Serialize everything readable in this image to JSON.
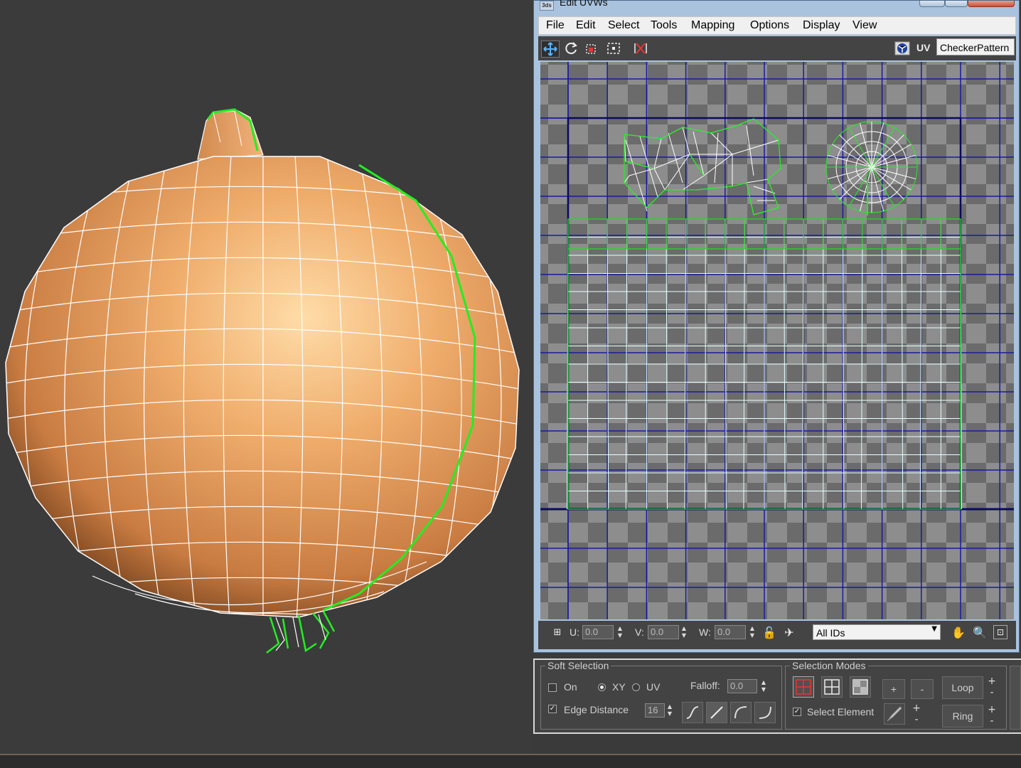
{
  "window": {
    "title": "Edit UVWs",
    "app_icon": "3ds"
  },
  "menu": [
    "File",
    "Edit",
    "Select",
    "Tools",
    "Mapping",
    "Options",
    "Display",
    "View"
  ],
  "toolbar": {
    "uv_label": "UV",
    "texture": "CheckerPattern"
  },
  "status": {
    "u_label": "U:",
    "u_value": "0.0",
    "v_label": "V:",
    "v_value": "0.0",
    "w_label": "W:",
    "w_value": "0.0",
    "id_filter": "All IDs"
  },
  "soft_selection": {
    "title": "Soft Selection",
    "on_label": "On",
    "on_checked": false,
    "xy_label": "XY",
    "uv_label": "UV",
    "mode": "XY",
    "falloff_label": "Falloff:",
    "falloff_value": "0.0",
    "edge_distance_label": "Edge Distance",
    "edge_distance_checked": true,
    "edge_distance_value": "16"
  },
  "selection_modes": {
    "title": "Selection Modes",
    "select_element_label": "Select Element",
    "select_element_checked": true,
    "loop_label": "Loop",
    "ring_label": "Ring",
    "plus": "+",
    "minus": "-"
  },
  "colors": {
    "viewport_bg": "#3b3b3b",
    "onion": "#e8a870",
    "wire": "#ffffff",
    "selection": "#22ee22",
    "uv_grid": "#1a1aa0",
    "window_frame": "#a9c3de"
  }
}
